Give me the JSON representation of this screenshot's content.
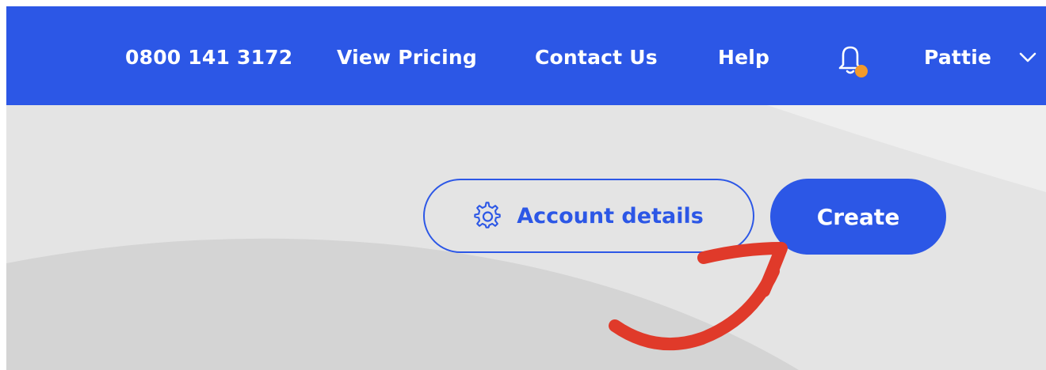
{
  "header": {
    "phone": "0800 141 3172",
    "pricing_link": "View Pricing",
    "contact_link": "Contact Us",
    "help_link": "Help",
    "user_name": "Pattie",
    "notification_icon": "bell-icon",
    "user_menu_icon": "chevron-down-icon"
  },
  "actions": {
    "account_details_label": "Account details",
    "account_details_icon": "gear-icon",
    "create_label": "Create"
  },
  "annotation": {
    "arrow_icon": "curved-arrow-icon",
    "arrow_color": "#e03a2a"
  },
  "colors": {
    "brand": "#2c57e6",
    "notification_dot": "#f39a2b",
    "background": "#e4e4e4"
  }
}
